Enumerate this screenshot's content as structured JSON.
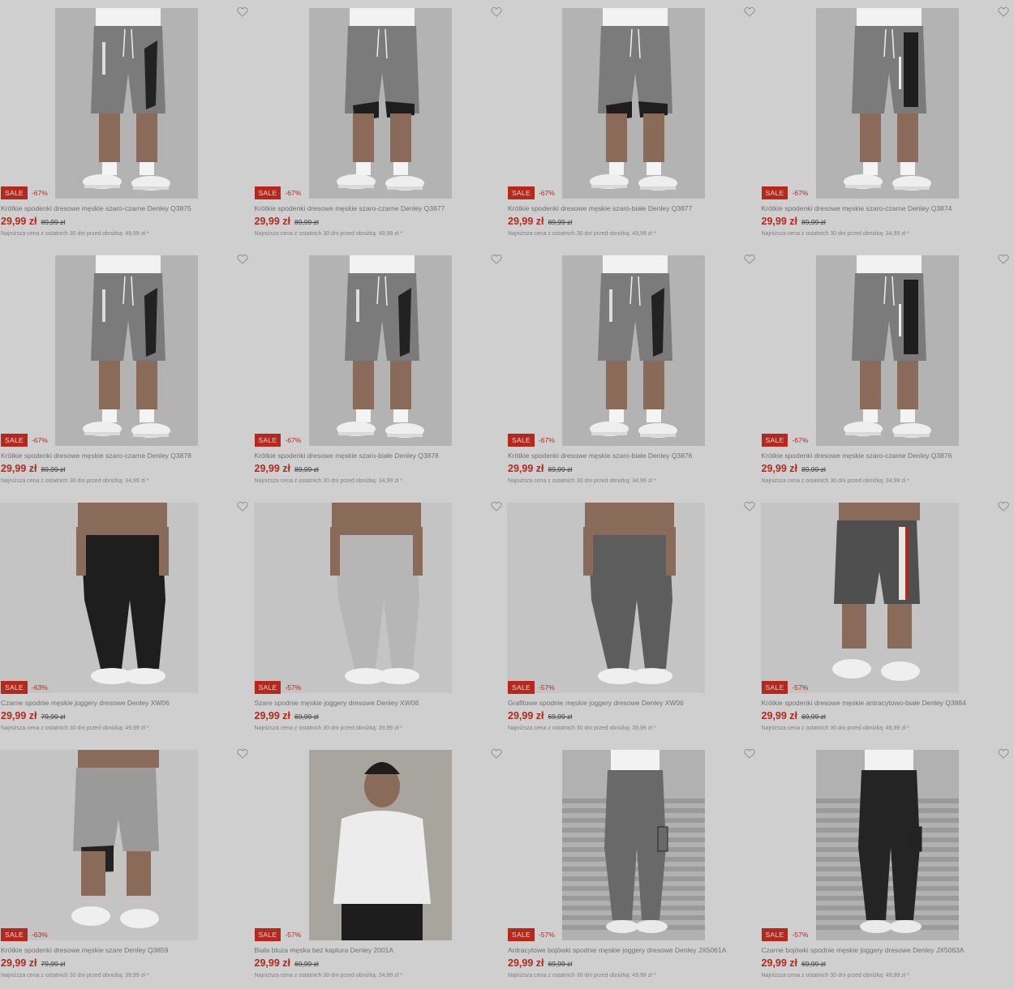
{
  "colors": {
    "accent": "#b5281d",
    "background": "#cfcfcf"
  },
  "icons": {
    "favorite": "heart-outline-icon"
  },
  "products": [
    {
      "type": "shorts",
      "variant": "zip",
      "badge": "SALE",
      "discount": "-67%",
      "title": "Krótkie spodenki dresowe męskie szaro-czarne Denley Q3875",
      "price": "29,99 zł",
      "old_price": "89,99 zł",
      "lowest": "Najniższa cena z ostatnich 30 dni przed obniżką: 49,99 zł *"
    },
    {
      "type": "shorts",
      "variant": "panel",
      "badge": "SALE",
      "discount": "-67%",
      "title": "Krótkie spodenki dresowe męskie szaro-czarne Denley Q3877",
      "price": "29,99 zł",
      "old_price": "89,99 zł",
      "lowest": "Najniższa cena z ostatnich 30 dni przed obniżką: 49,99 zł *"
    },
    {
      "type": "shorts",
      "variant": "panel",
      "badge": "SALE",
      "discount": "-67%",
      "title": "Krótkie spodenki dresowe męskie szaro-białe Denley Q3877",
      "price": "29,99 zł",
      "old_price": "89,99 zł",
      "lowest": "Najniższa cena z ostatnich 30 dni przed obniżką: 49,99 zł *"
    },
    {
      "type": "shorts",
      "variant": "stripe",
      "badge": "SALE",
      "discount": "-67%",
      "title": "Krótkie spodenki dresowe męskie szaro-czarne Denley Q3874",
      "price": "29,99 zł",
      "old_price": "89,99 zł",
      "lowest": "Najniższa cena z ostatnich 30 dni przed obniżką: 34,99 zł *"
    },
    {
      "type": "shorts",
      "variant": "zip",
      "badge": "SALE",
      "discount": "-67%",
      "title": "Krótkie spodenki dresowe męskie szaro-czarne Denley Q3878",
      "price": "29,99 zł",
      "old_price": "89,99 zł",
      "lowest": "Najniższa cena z ostatnich 30 dni przed obniżką: 34,99 zł *"
    },
    {
      "type": "shorts",
      "variant": "zip",
      "badge": "SALE",
      "discount": "-67%",
      "title": "Krótkie spodenki dresowe męskie szaro-białe Denley Q3878",
      "price": "29,99 zł",
      "old_price": "89,99 zł",
      "lowest": "Najniższa cena z ostatnich 30 dni przed obniżką: 34,99 zł *"
    },
    {
      "type": "shorts",
      "variant": "zip",
      "badge": "SALE",
      "discount": "-67%",
      "title": "Krótkie spodenki dresowe męskie szaro-białe Denley Q3876",
      "price": "29,99 zł",
      "old_price": "89,99 zł",
      "lowest": "Najniższa cena z ostatnich 30 dni przed obniżką: 34,99 zł *"
    },
    {
      "type": "shorts",
      "variant": "stripe",
      "badge": "SALE",
      "discount": "-67%",
      "title": "Krótkie spodenki dresowe męskie szaro-czarne Denley Q3876",
      "price": "29,99 zł",
      "old_price": "89,99 zł",
      "lowest": "Najniższa cena z ostatnich 30 dni przed obniżką: 34,99 zł *"
    },
    {
      "type": "joggers",
      "variant": "black",
      "badge": "SALE",
      "discount": "-63%",
      "title": "Czarne spodnie męskie joggery dresowe Denley XW06",
      "price": "29,99 zł",
      "old_price": "79,99 zł",
      "lowest": "Najniższa cena z ostatnich 30 dni przed obniżką: 49,99 zł *"
    },
    {
      "type": "joggers",
      "variant": "grey",
      "badge": "SALE",
      "discount": "-57%",
      "title": "Szare spodnie męskie joggery dresowe Denley XW06",
      "price": "29,99 zł",
      "old_price": "69,99 zł",
      "lowest": "Najniższa cena z ostatnich 30 dni przed obniżką: 39,99 zł *"
    },
    {
      "type": "joggers",
      "variant": "graphite",
      "badge": "SALE",
      "discount": "-57%",
      "title": "Grafitowe spodnie męskie joggery dresowe Denley XW06",
      "price": "29,99 zł",
      "old_price": "69,99 zł",
      "lowest": "Najniższa cena z ostatnich 30 dni przed obniżką: 39,99 zł *"
    },
    {
      "type": "shorts-wide",
      "variant": "anthracite",
      "badge": "SALE",
      "discount": "-57%",
      "title": "Krótkie spodenki dresowe męskie antracytowo-białe Denley Q3884",
      "price": "29,99 zł",
      "old_price": "69,99 zł",
      "lowest": "Najniższa cena z ostatnich 30 dni przed obniżką: 49,99 zł *"
    },
    {
      "type": "shorts-wide",
      "variant": "grey",
      "badge": "SALE",
      "discount": "-63%",
      "title": "Krótkie spodenki dresowe męskie szare Denley Q3859",
      "price": "29,99 zł",
      "old_price": "79,99 zł",
      "lowest": "Najniższa cena z ostatnich 30 dni przed obniżką: 39,99 zł *"
    },
    {
      "type": "sweater",
      "variant": "white",
      "badge": "SALE",
      "discount": "-57%",
      "title": "Biała bluza męska bez kaptura Denley 2001A",
      "price": "29,99 zł",
      "old_price": "69,99 zł",
      "lowest": "Najniższa cena z ostatnich 30 dni przed obniżką: 34,99 zł *"
    },
    {
      "type": "cargo",
      "variant": "anthracite",
      "badge": "SALE",
      "discount": "-57%",
      "title": "Antracytowe bojówki spodnie męskie joggery dresowe Denley JX5061A",
      "price": "29,99 zł",
      "old_price": "69,99 zł",
      "lowest": "Najniższa cena z ostatnich 30 dni przed obniżką: 49,99 zł *"
    },
    {
      "type": "cargo",
      "variant": "black",
      "badge": "SALE",
      "discount": "-57%",
      "title": "Czarne bojówki spodnie męskie joggery dresowe Denley JX5063A",
      "price": "29,99 zł",
      "old_price": "69,99 zł",
      "lowest": "Najniższa cena z ostatnich 30 dni przed obniżką: 49,99 zł *"
    }
  ]
}
